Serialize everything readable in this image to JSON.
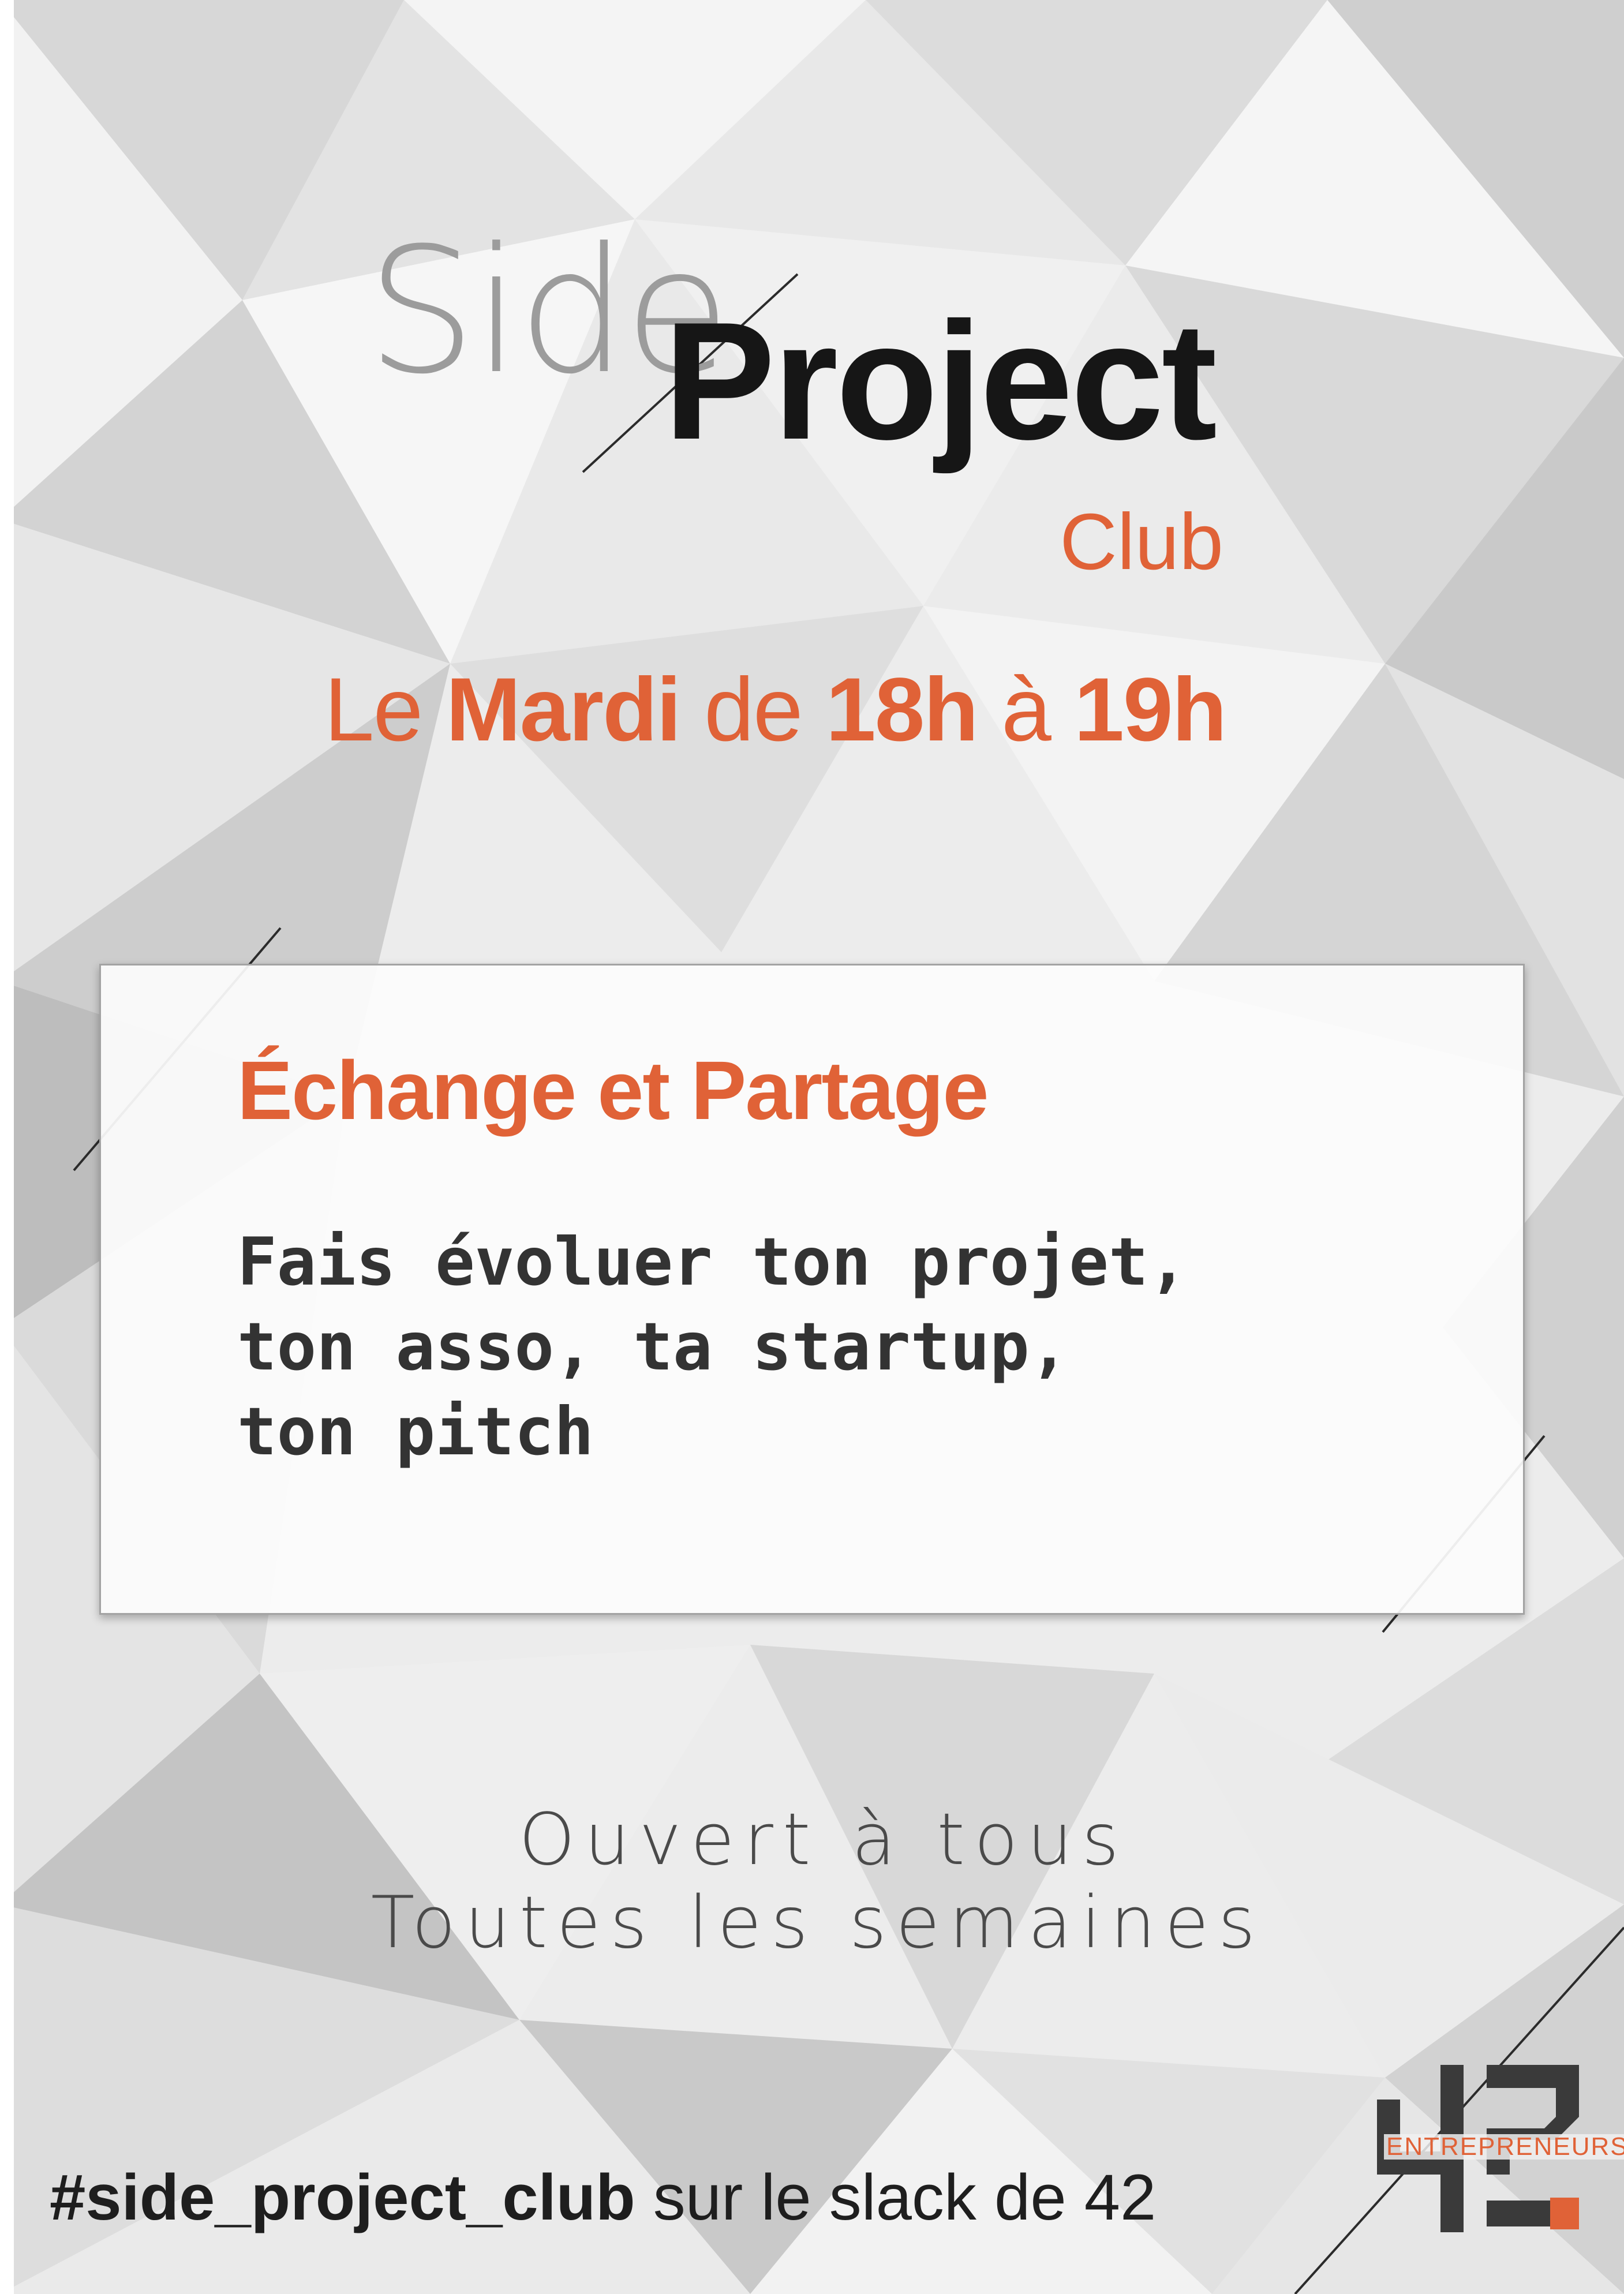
{
  "poster": {
    "title": {
      "side": "Side",
      "project": "Project",
      "club": "Club"
    },
    "schedule": {
      "le": "Le ",
      "day": "Mardi",
      "de": " de ",
      "start": "18h",
      "a": " à ",
      "end": "19h"
    },
    "card": {
      "title": "Échange et Partage",
      "body_lines": [
        "Fais évoluer ton projet,",
        "ton asso, ta startup,",
        "ton pitch"
      ]
    },
    "tagline": {
      "line1": "Ouvert à tous",
      "line2": "Toutes les semaines"
    },
    "footer": {
      "channel": "#side_project_club",
      "rest": " sur le slack de 42"
    },
    "logo": {
      "text": "ENTREPRENEURS",
      "icon": "42-entrepreneurs-logo-icon"
    },
    "colors": {
      "accent": "#e06237",
      "dark": "#161616",
      "muted": "#9c9c9c",
      "background": "#ededed"
    }
  }
}
